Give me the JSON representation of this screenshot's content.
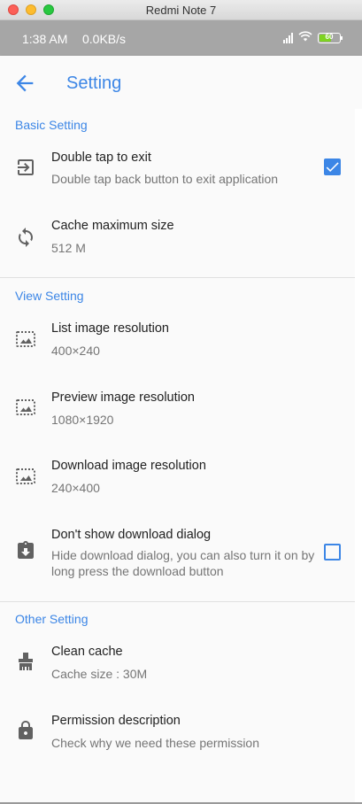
{
  "window": {
    "title": "Redmi Note 7"
  },
  "status_bar": {
    "time": "1:38 AM",
    "speed": "0.0KB/s",
    "battery": "60",
    "battery_level": 0.6
  },
  "app_bar": {
    "title": "Setting"
  },
  "colors": {
    "accent": "#3c86e6",
    "status_bar": "#a6a6a6",
    "background": "#fafafa"
  },
  "sections": {
    "basic": {
      "header": "Basic Setting",
      "double_tap": {
        "title": "Double tap to exit",
        "subtitle": "Double tap back button to exit application",
        "icon": "exit-to-app-icon",
        "checked": true
      },
      "cache_max": {
        "title": "Cache maximum size",
        "subtitle": "512 M",
        "icon": "sync-icon"
      }
    },
    "view": {
      "header": "View Setting",
      "list_res": {
        "title": "List image resolution",
        "subtitle": "400×240",
        "icon": "image-selection-icon"
      },
      "preview_res": {
        "title": "Preview image resolution",
        "subtitle": "1080×1920",
        "icon": "image-selection-icon"
      },
      "download_res": {
        "title": "Download image resolution",
        "subtitle": "240×400",
        "icon": "image-selection-icon"
      },
      "no_dialog": {
        "title": "Don't show download dialog",
        "subtitle": "Hide download dialog, you can also turn it on by long press the download button",
        "icon": "clipboard-download-icon",
        "checked": false
      }
    },
    "other": {
      "header": "Other Setting",
      "clean_cache": {
        "title": "Clean cache",
        "subtitle": "Cache size : 30M",
        "icon": "broom-icon"
      },
      "permission": {
        "title": "Permission description",
        "subtitle": "Check why we need these permission",
        "icon": "lock-icon"
      }
    }
  }
}
